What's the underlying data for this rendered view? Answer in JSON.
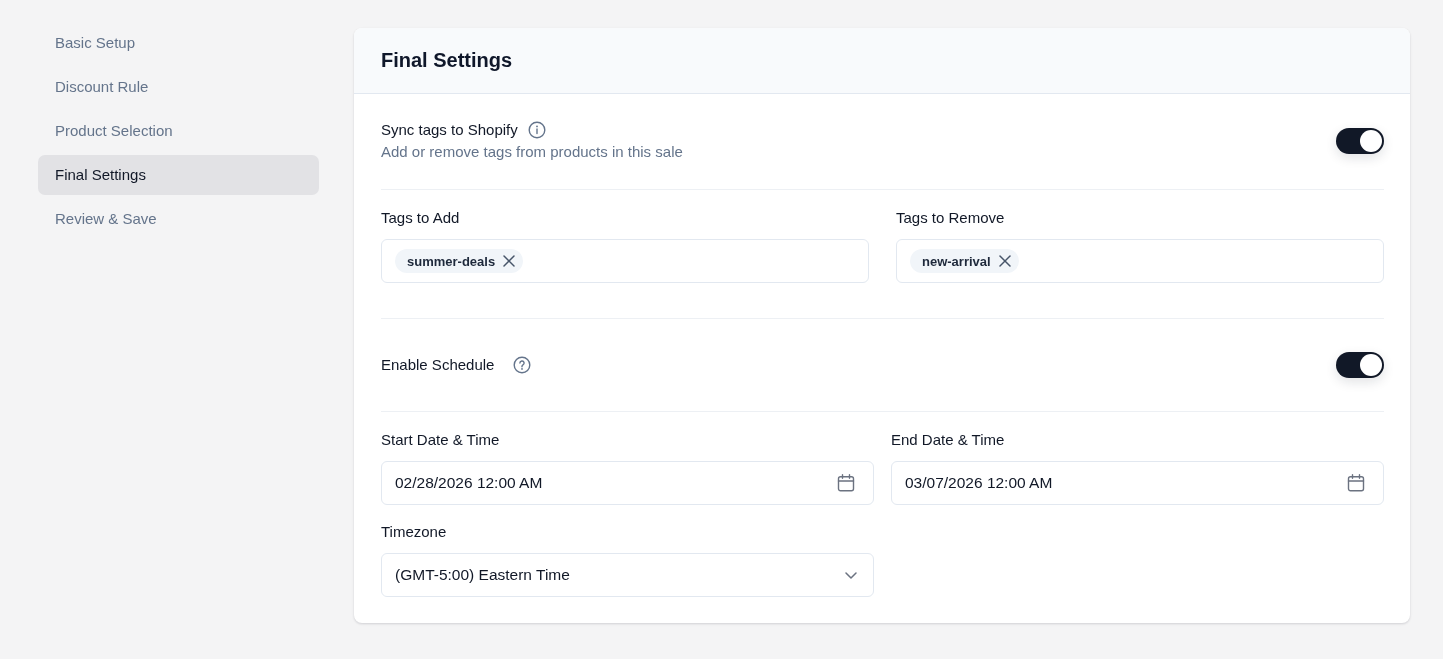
{
  "sidebar": {
    "items": [
      {
        "label": "Basic Setup",
        "selected": false
      },
      {
        "label": "Discount Rule",
        "selected": false
      },
      {
        "label": "Product Selection",
        "selected": false
      },
      {
        "label": "Final Settings",
        "selected": true
      },
      {
        "label": "Review & Save",
        "selected": false
      }
    ]
  },
  "panel": {
    "title": "Final Settings",
    "sync": {
      "title": "Sync tags to Shopify",
      "description": "Add or remove tags from products in this sale",
      "on": true
    },
    "tag_fields": [
      {
        "label": "Tags to Add",
        "tags": [
          "summer-deals"
        ]
      },
      {
        "label": "Tags to Remove",
        "tags": [
          "new-arrival"
        ]
      }
    ],
    "schedule": {
      "title": "Enable Schedule",
      "on": true
    },
    "date_fields": [
      {
        "label": "Start Date & Time",
        "value": "02/28/2026 12:00 AM"
      },
      {
        "label": "End Date & Time",
        "value": "03/07/2026 12:00 AM"
      }
    ],
    "timezone": {
      "label": "Timezone",
      "value": "(GMT-5:00) Eastern Time"
    }
  }
}
